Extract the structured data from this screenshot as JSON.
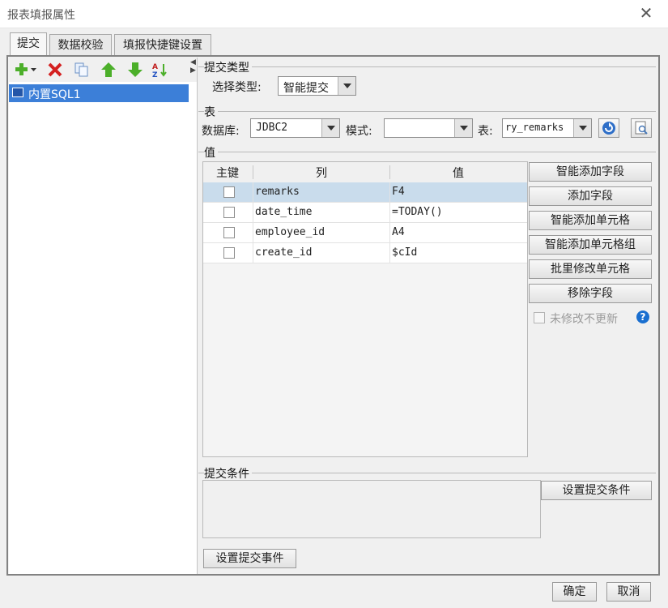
{
  "window": {
    "title": "报表填报属性",
    "close_glyph": "✕"
  },
  "tabs": [
    {
      "label": "提交",
      "active": true
    },
    {
      "label": "数据校验",
      "active": false
    },
    {
      "label": "填报快捷键设置",
      "active": false
    }
  ],
  "left_panel": {
    "toolbar_icons": [
      "add-dropdown-icon",
      "delete-icon",
      "copy-icon",
      "move-up-icon",
      "move-down-icon",
      "sort-icon"
    ],
    "tree_items": [
      {
        "label": "内置SQL1",
        "selected": true
      }
    ]
  },
  "submit_type": {
    "group_title": "提交类型",
    "label": "选择类型:",
    "value": "智能提交"
  },
  "table_group": {
    "group_title": "表",
    "database_label": "数据库:",
    "database_value": "JDBC2",
    "schema_label": "模式:",
    "schema_value": "",
    "table_label": "表:",
    "table_value": "ry_remarks"
  },
  "values_group": {
    "group_title": "值",
    "columns": [
      "主键",
      "列",
      "值"
    ],
    "rows": [
      {
        "primary_key": false,
        "column": "remarks",
        "value": "F4",
        "selected": true
      },
      {
        "primary_key": false,
        "column": "date_time",
        "value": "=TODAY()",
        "selected": false
      },
      {
        "primary_key": false,
        "column": "employee_id",
        "value": "A4",
        "selected": false
      },
      {
        "primary_key": false,
        "column": "create_id",
        "value": "$cId",
        "selected": false
      }
    ],
    "buttons": [
      "智能添加字段",
      "添加字段",
      "智能添加单元格",
      "智能添加单元格组",
      "批里修改单元格",
      "移除字段"
    ],
    "no_update_checkbox": {
      "label": "未修改不更新",
      "checked": false,
      "enabled": false
    }
  },
  "condition_group": {
    "group_title": "提交条件",
    "button": "设置提交条件"
  },
  "event_button": "设置提交事件",
  "footer": {
    "ok": "确定",
    "cancel": "取消"
  },
  "colors": {
    "selection": "#3c7fd8",
    "row_selected": "#c9dcec",
    "help_icon": "#1a6fd0"
  }
}
